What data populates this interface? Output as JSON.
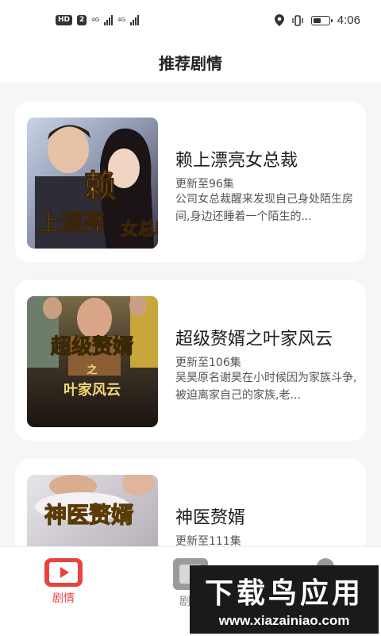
{
  "status_bar": {
    "hd_badge": "HD",
    "sim_slot": "2",
    "network_1": "4G",
    "network_2": "4G",
    "time": "4:06",
    "battery_level": 0.55,
    "icons": [
      "location-icon",
      "vibrate-icon",
      "battery-icon"
    ]
  },
  "header": {
    "title": "推荐剧情"
  },
  "dramas": [
    {
      "title": "赖上漂亮女总裁",
      "episodes": "更新至96集",
      "description": "公司女总裁醒来发现自己身处陌生房间,身边还睡着一个陌生的...",
      "poster_text": "赖上漂亮女总裁"
    },
    {
      "title": "超级赘婿之叶家风云",
      "episodes": "更新至106集",
      "description": "吴昊原名谢昊在小时候因为家族斗争,被迫离家自己的家族,老...",
      "poster_text": "超级赘婿之叶家风云"
    },
    {
      "title": "神医赘婿",
      "episodes": "更新至111集",
      "description": "",
      "poster_text": "神医赘婿"
    }
  ],
  "bottom_nav": {
    "items": [
      {
        "label": "剧情",
        "icon": "play-video-icon",
        "active": true
      },
      {
        "label": "剧",
        "icon": "drama-icon",
        "active": false
      },
      {
        "label": "",
        "icon": "profile-icon",
        "active": false
      }
    ],
    "active_color": "#e8443f"
  },
  "watermark": {
    "text": "下载鸟应用",
    "url": "www.xiazainiao.com"
  }
}
